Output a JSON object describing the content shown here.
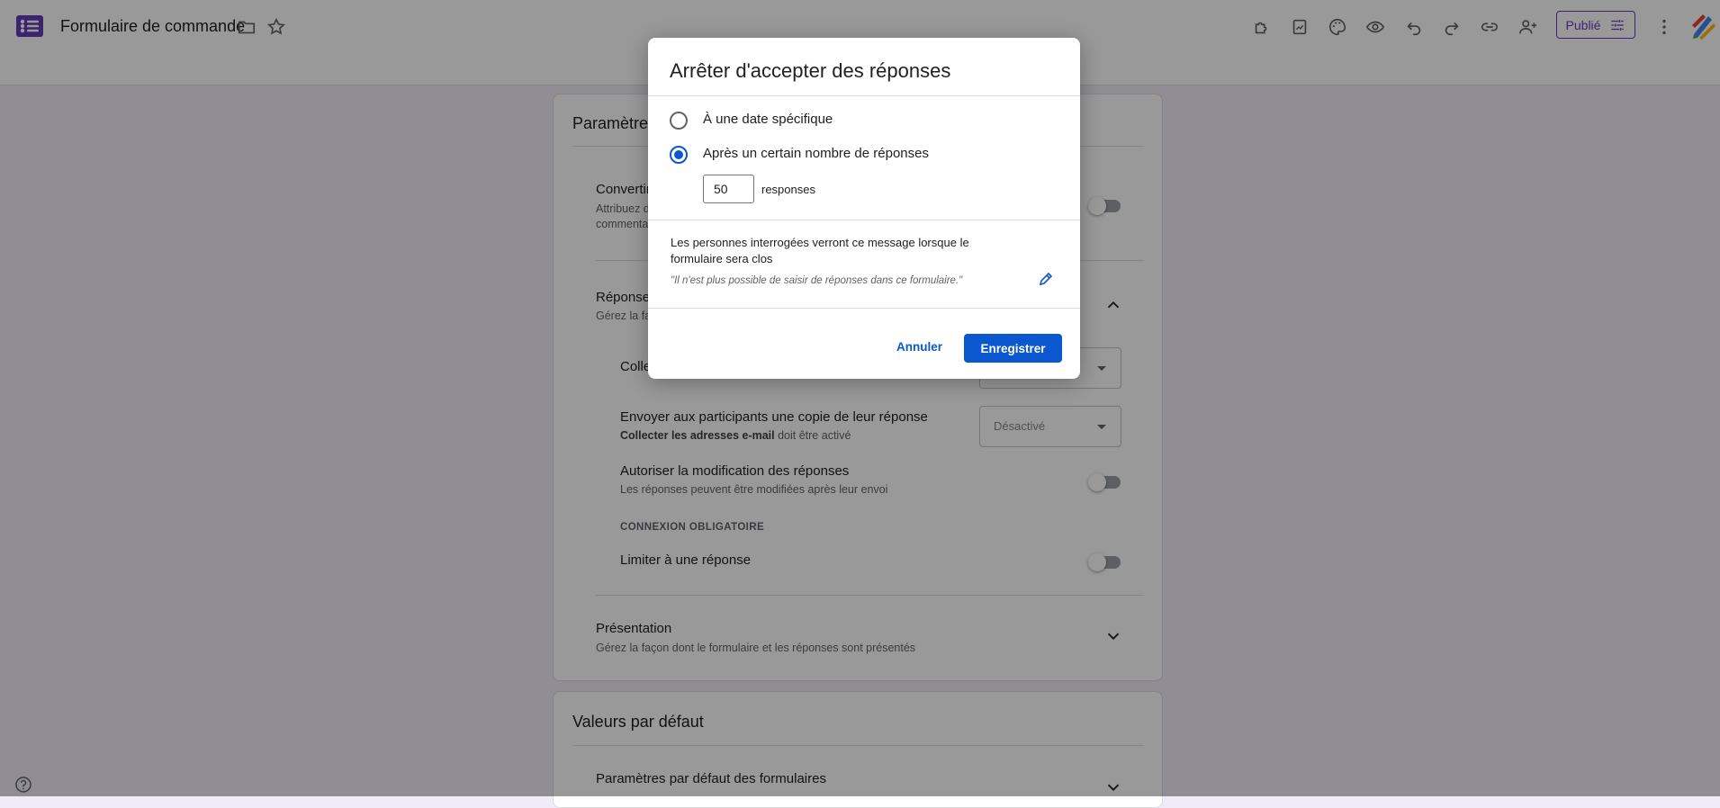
{
  "header": {
    "title": "Formulaire de commande",
    "publish_label": "Publié",
    "icons": [
      "addons-icon",
      "present-icon",
      "palette-icon",
      "preview-icon",
      "undo-icon",
      "redo-icon",
      "link-icon",
      "add-collaborator-icon"
    ]
  },
  "settings": {
    "card1_title": "Paramètres",
    "convert": {
      "title": "Convertir",
      "sub1": "Attribuez d",
      "sub2": "commenta"
    },
    "responses": {
      "title": "Réponses",
      "sub": "Gérez la faç",
      "collect_title": "Colle",
      "send_copy_title": "Envoyer aux participants une copie de leur réponse",
      "send_copy_sub_bold": "Collecter les adresses e-mail",
      "send_copy_sub_rest": " doit être activé",
      "send_copy_value": "Désactivé",
      "allow_edit_title": "Autoriser la modification des réponses",
      "allow_edit_sub": "Les réponses peuvent être modifiées après leur envoi",
      "login_required": "CONNEXION OBLIGATOIRE",
      "limit_title": "Limiter à une réponse"
    },
    "presentation": {
      "title": "Présentation",
      "sub": "Gérez la façon dont le formulaire et les réponses sont présentés"
    },
    "card2_title": "Valeurs par défaut",
    "defaults": {
      "title": "Paramètres par défaut des formulaires"
    }
  },
  "dialog": {
    "title": "Arrêter d'accepter des réponses",
    "option_date": "À une date spécifique",
    "option_count": "Après un certain nombre de réponses",
    "selected_option": "option_count",
    "count_value": "50",
    "count_unit": "responses",
    "message_heading": "Les personnes interrogées verront ce message lorsque le formulaire sera clos",
    "message_text": "\"Il n'est plus possible de saisir de réponses dans ce formulaire.\"",
    "cancel_label": "Annuler",
    "save_label": "Enregistrer"
  },
  "colors": {
    "accent_purple": "#673ab7",
    "primary_blue": "#0b57d0",
    "page_bg": "#f0ebf8"
  }
}
